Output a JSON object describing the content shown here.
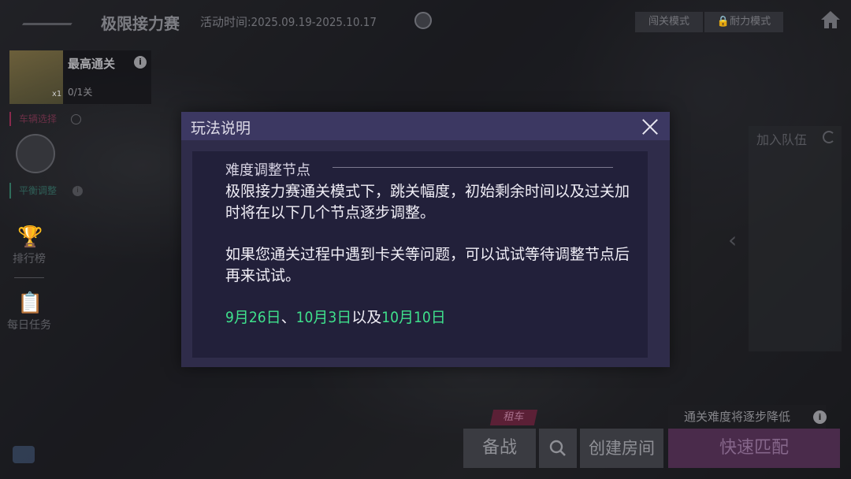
{
  "topbar": {
    "event_title": "极限接力赛",
    "event_time": "活动时间:2025.09.19-2025.10.17",
    "mode_challenge": "闯关模式",
    "mode_endurance": "耐力模式"
  },
  "left_panel": {
    "best_label": "最高通关",
    "best_progress": "0/1关",
    "thumb_count": "x1",
    "tag_red": "车辆选择",
    "tag_green": "平衡调整",
    "nav_rank": "排行榜",
    "nav_daily": "每日任务"
  },
  "right_panel": {
    "join_team": "加入队伍"
  },
  "bottom": {
    "hint": "通关难度将逐步降低",
    "rent_tag": "租车",
    "prepare": "备战",
    "create_room": "创建房间",
    "quick_match": "快速匹配"
  },
  "modal": {
    "title": "玩法说明",
    "section_title": "难度调整节点",
    "paragraph1": "极限接力赛通关模式下，跳关幅度，初始剩余时间以及过关加时将在以下几个节点逐步调整。",
    "paragraph2": "如果您通关过程中遇到卡关等问题，可以试试等待调整节点后再来试试。",
    "date1": "9月26日",
    "sep1": "、",
    "date2": "10月3日",
    "sep2": "以及",
    "date3": "10月10日"
  },
  "colors": {
    "modal_header": "#3c3862",
    "modal_bg": "#2f2c4a",
    "modal_body": "#22203a",
    "date_highlight": "#3fe08c",
    "quick_match_bg": "#4a2b4b"
  }
}
